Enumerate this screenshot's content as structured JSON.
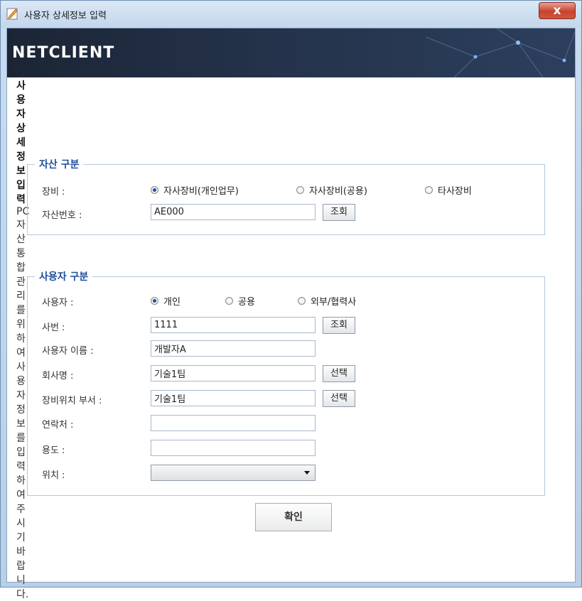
{
  "window": {
    "title": "사용자 상세정보 입력",
    "close_label": "x"
  },
  "banner": {
    "logo": "NETCLIENT"
  },
  "heading": {
    "title": "사용자 상세정보 입력",
    "description": "PC자산 통합관리를 위하여 사용자 정보를 입력하여 주시기 바랍니다."
  },
  "asset_group": {
    "title": "자산 구분",
    "equipment_label": "장비 :",
    "equipment_options": [
      {
        "label": "자사장비(개인업무)",
        "selected": true
      },
      {
        "label": "자사장비(공용)",
        "selected": false
      },
      {
        "label": "타사장비",
        "selected": false
      }
    ],
    "asset_no_label": "자산번호 :",
    "asset_no_value": "AE000",
    "lookup_label": "조회"
  },
  "user_group": {
    "title": "사용자 구분",
    "user_label": "사용자 :",
    "user_options": [
      {
        "label": "개인",
        "selected": true
      },
      {
        "label": "공용",
        "selected": false
      },
      {
        "label": "외부/협력사",
        "selected": false
      }
    ],
    "emp_no_label": "사번 :",
    "emp_no_value": "1111",
    "emp_lookup_label": "조회",
    "user_name_label": "사용자 이름 :",
    "user_name_value": "개발자A",
    "company_label": "회사명 :",
    "company_value": "기술1팀",
    "company_select_label": "선택",
    "dept_label": "장비위치 부서 :",
    "dept_value": "기술1팀",
    "dept_select_label": "선택",
    "contact_label": "연락처 :",
    "contact_value": "",
    "purpose_label": "용도 :",
    "purpose_value": "",
    "location_label": "위치 :",
    "location_value": ""
  },
  "footer": {
    "ok_label": "확인"
  },
  "colors": {
    "group_title": "#1f4f9c",
    "banner": "#1b2535",
    "close": "#c5432e"
  }
}
